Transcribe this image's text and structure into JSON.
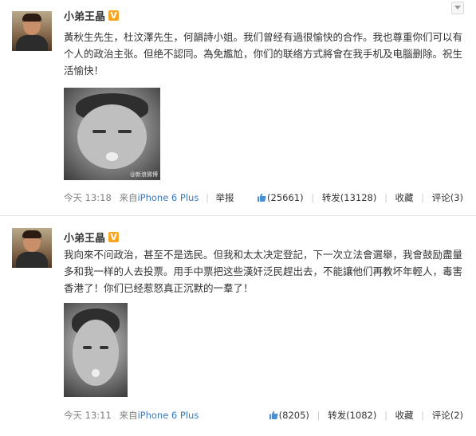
{
  "posts": [
    {
      "username": "小弟王晶",
      "verified_badge": "V",
      "text": "黃秋生先生，杜汶澤先生，何韻詩小姐。我们曾经有過很愉快的合作。我也尊重你们可以有个人的政治主张。但绝不認同。為免尷尬，你们的联络方式將會在我手机及电腦删除。祝生活愉快！",
      "image_watermark": "@新浪微博",
      "time": "今天 13:18",
      "source_prefix": "来自",
      "source": "iPhone 6 Plus",
      "report": "举报",
      "likes": "(25661)",
      "repost_label": "转发",
      "repost_count": "(13128)",
      "favorite_label": "收藏",
      "comment_label": "评论",
      "comment_count": "(3)"
    },
    {
      "username": "小弟王晶",
      "verified_badge": "V",
      "text": "我向來不问政治，甚至不是选民。但我和太太决定登記，下一次立法會選舉，我會鼓励盡量多和我一样的人去投票。用手中票把这些漢奸泛民趕出去，不能讓他们再教坏年輕人，毒害香港了！你们已经惹怒真正沉默的一羣了！",
      "time": "今天 13:11",
      "source_prefix": "来自",
      "source": "iPhone 6 Plus",
      "likes": "(8205)",
      "repost_label": "转发",
      "repost_count": "(1082)",
      "favorite_label": "收藏",
      "comment_label": "评论",
      "comment_count": "(2)"
    }
  ],
  "colors": {
    "link": "#3779c1",
    "meta": "#808080",
    "badge": "#f6a623",
    "like_icon": "#4a90d9"
  },
  "icons": {
    "like": "thumbs-up-icon",
    "menu": "chevron-down-icon"
  }
}
